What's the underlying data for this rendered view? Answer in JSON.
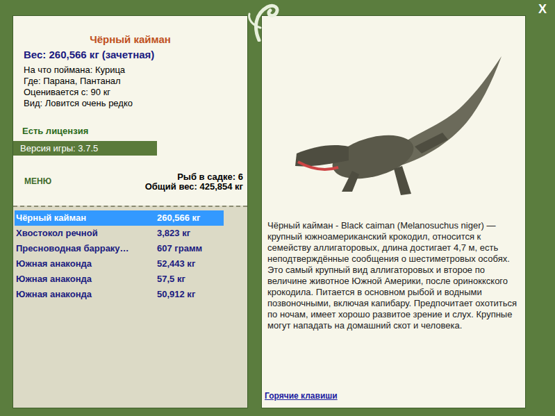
{
  "window": {
    "close": "X"
  },
  "catch": {
    "title": "Чёрный кайман",
    "weight": "Вес: 260,566 кг (зачетная)",
    "details": [
      "На что поймана: Курица",
      "Где: Парана, Пантанал",
      "Оценивается с: 90 кг",
      "Вид: Ловится очень редко"
    ],
    "license": "Есть лицензия",
    "version": "Версия игры: 3.7.5"
  },
  "menu": "МЕНЮ",
  "keepnet": {
    "count": "Рыб в садке: 6",
    "total": "Общий вес: 425,854 кг"
  },
  "fish_list": [
    {
      "name": "Чёрный кайман",
      "weight": "260,566 кг",
      "selected": true
    },
    {
      "name": "Хвостокол речной",
      "weight": "3,823 кг",
      "selected": false
    },
    {
      "name": "Пресноводная барраку…",
      "weight": "607 грамм",
      "selected": false
    },
    {
      "name": "Южная анаконда",
      "weight": "52,443 кг",
      "selected": false
    },
    {
      "name": "Южная анаконда",
      "weight": "57,5 кг",
      "selected": false
    },
    {
      "name": "Южная анаконда",
      "weight": "50,912 кг",
      "selected": false
    }
  ],
  "description": "Чёрный кайман - Black caiman (Melanosuchus niger) — крупный южноамериканский крокодил, относится к семейству аллигаторовых, длина достигает 4,7 м, есть неподтверждённые сообщения о шестиметровых особях. Это самый крупный вид аллигаторовых и второе по величине животное Южной Америки, после ориноккского крокодила. Питается в основном рыбой и водными позвоночными, включая капибару. Предпочитает охотиться по ночам, имеет хорошо развитое зрение и слух. Крупные могут нападать на домашний скот и человека.",
  "hotkeys_link": "Горячие клавиши"
}
